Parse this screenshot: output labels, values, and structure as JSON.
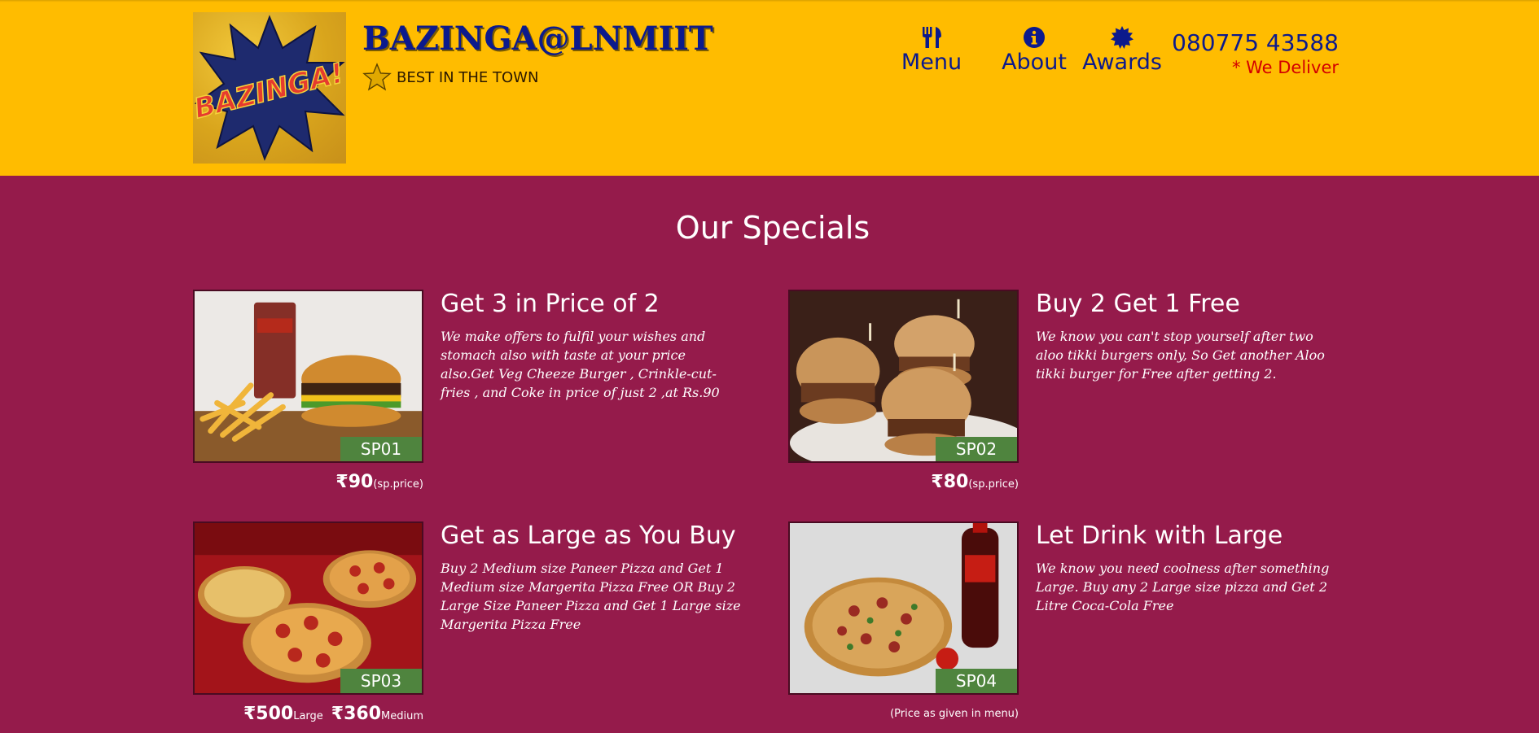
{
  "header": {
    "brand_name": "BAZINGA@LNMIIT",
    "logo_text": "BAZINGA!",
    "tagline": "BEST IN THE TOWN",
    "nav": [
      {
        "label": "Menu",
        "icon": "utensils-icon"
      },
      {
        "label": "About",
        "icon": "info-circle-icon"
      },
      {
        "label": "Awards",
        "icon": "certificate-icon"
      }
    ],
    "phone": "080775 43588",
    "deliver": "* We Deliver"
  },
  "colors": {
    "header_bg": "#ffbc00",
    "page_bg": "#951b4b",
    "brand_blue": "#0c1a8c",
    "deliver_red": "#d30000",
    "badge_green": "#4f843e"
  },
  "specials": {
    "title": "Our Specials",
    "items": [
      {
        "code": "SP01",
        "title": "Get 3 in Price of 2",
        "description": "We make offers to fulfil your wishes and stomach also with taste at your price also.Get Veg Cheeze Burger , Crinkle-cut-fries , and Coke in price of just 2 ,at Rs.90",
        "price": "₹90",
        "price_note": "(sp.price)"
      },
      {
        "code": "SP02",
        "title": "Buy 2 Get 1 Free",
        "description": "We know you can't stop yourself after two aloo tikki burgers only, So Get another Aloo tikki burger for Free after getting 2.",
        "price": "₹80",
        "price_note": "(sp.price)"
      },
      {
        "code": "SP03",
        "title": "Get as Large as You Buy",
        "description": "Buy 2 Medium size Paneer Pizza and Get 1 Medium size Margerita Pizza Free OR Buy 2 Large Size Paneer Pizza and Get 1 Large size Margerita Pizza Free",
        "price_large": "₹500",
        "price_large_label": "Large",
        "price_medium": "₹360",
        "price_medium_label": "Medium"
      },
      {
        "code": "SP04",
        "title": "Let Drink with Large",
        "description": "We know you need coolness after something Large. Buy any 2 Large size pizza and Get 2 Litre Coca-Cola Free",
        "price_note": "(Price as given in menu)"
      }
    ]
  }
}
